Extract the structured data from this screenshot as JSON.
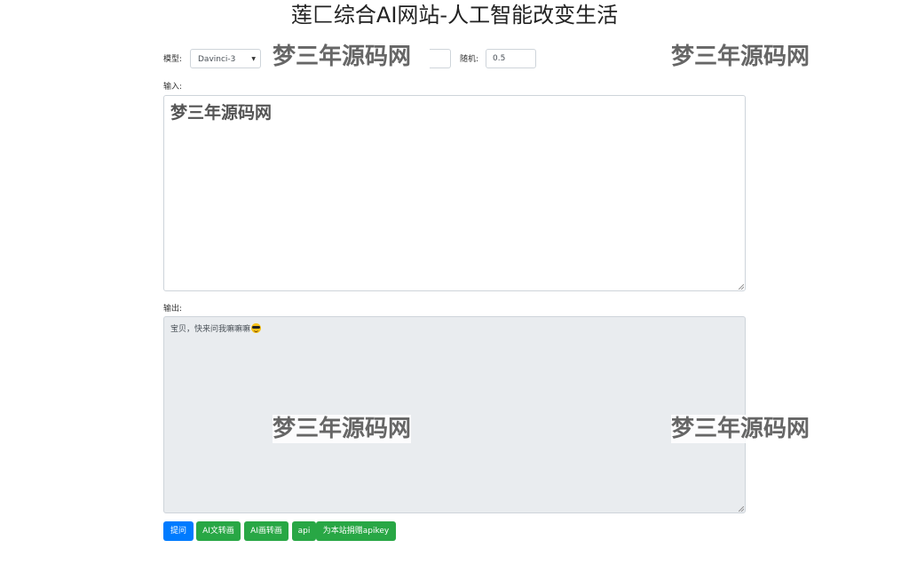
{
  "header": {
    "title": "莲匚综合AI网站-人工智能改变生活"
  },
  "toolbar": {
    "model_label": "模型:",
    "model_value": "Davinci-3",
    "model_caret": "▼",
    "random_label": "随机:",
    "random_value": "0.5"
  },
  "input": {
    "label": "输入:",
    "overlay_text": "梦三年源码网"
  },
  "output": {
    "label": "输出:",
    "text": "宝贝，快来问我嘛嘛嘛",
    "emoji_icon": "sunglasses-face-icon"
  },
  "buttons": {
    "ask": "提问",
    "ai_text_to_image": "AI文转画",
    "ai_image_to_image": "AI画转画",
    "api": "api",
    "donate_apikey": "为本站捐赠apikey"
  },
  "watermarks": {
    "text": "梦三年源码网"
  },
  "colors": {
    "primary": "#007bff",
    "success": "#28a745",
    "output_bg": "#e9ecef"
  }
}
